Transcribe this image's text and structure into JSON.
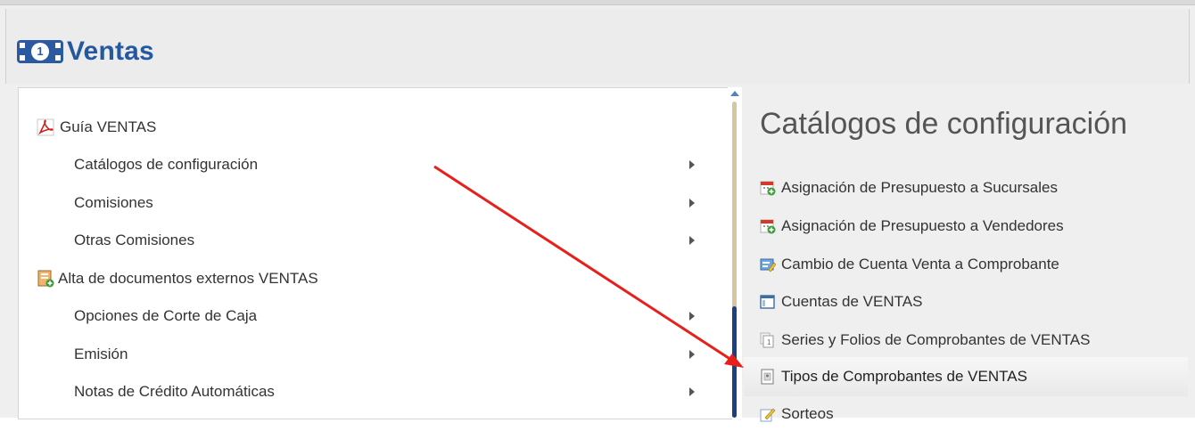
{
  "header": {
    "title": "Ventas",
    "icon": "money-icon",
    "accent": "#24589f"
  },
  "left_menu": {
    "items": [
      {
        "label": "Guía VENTAS",
        "icon": "pdf-icon",
        "submenu": false
      },
      {
        "label": "Catálogos de configuración",
        "submenu": true
      },
      {
        "label": "Comisiones",
        "submenu": true
      },
      {
        "label": "Otras Comisiones",
        "submenu": true
      },
      {
        "label": "Alta de documentos externos VENTAS",
        "icon": "add-document-icon",
        "submenu": false
      },
      {
        "label": "Opciones de Corte de Caja",
        "submenu": true
      },
      {
        "label": "Emisión",
        "submenu": true
      },
      {
        "label": "Notas de Crédito Automáticas",
        "submenu": true
      }
    ]
  },
  "right_menu": {
    "title": "Catálogos de configuración",
    "items": [
      {
        "label": "Asignación de Presupuesto a Sucursales",
        "icon": "calendar-add-icon"
      },
      {
        "label": "Asignación de Presupuesto a Vendedores",
        "icon": "calendar-add-icon"
      },
      {
        "label": "Cambio de Cuenta Venta a Comprobante",
        "icon": "edit-form-icon"
      },
      {
        "label": "Cuentas de VENTAS",
        "icon": "window-icon"
      },
      {
        "label": "Series y Folios de Comprobantes de VENTAS",
        "icon": "series-icon"
      },
      {
        "label": "Tipos de Comprobantes de VENTAS",
        "icon": "document-type-icon",
        "highlighted": true
      },
      {
        "label": "Sorteos",
        "icon": "pencil-icon"
      }
    ]
  },
  "annotation": {
    "color": "#e8201c",
    "icon": "red-arrow"
  }
}
